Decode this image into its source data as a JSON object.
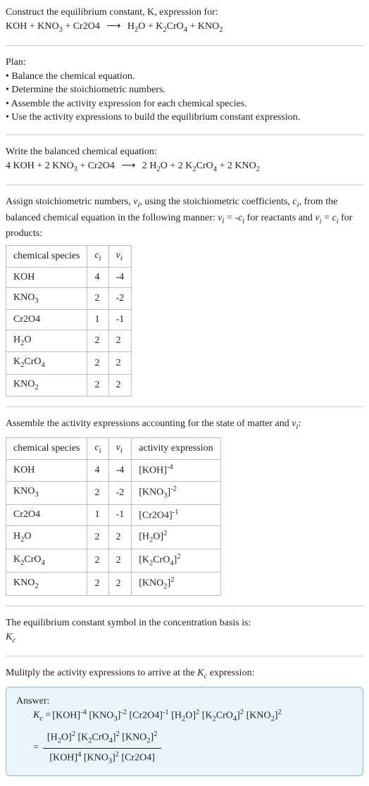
{
  "s1": {
    "intro": "Construct the equilibrium constant, K, expression for:",
    "equation": "KOH + KNO₃ + Cr2O4  ⟶  H₂O + K₂CrO₄ + KNO₂"
  },
  "plan": {
    "title": "Plan:",
    "b1": "• Balance the chemical equation.",
    "b2": "• Determine the stoichiometric numbers.",
    "b3": "• Assemble the activity expression for each chemical species.",
    "b4": "• Use the activity expressions to build the equilibrium constant expression."
  },
  "balanced": {
    "title": "Write the balanced chemical equation:",
    "equation": "4 KOH + 2 KNO₃ + Cr2O4  ⟶  2 H₂O + 2 K₂CrO₄ + 2 KNO₂"
  },
  "stoich": {
    "intro": "Assign stoichiometric numbers, νᵢ, using the stoichiometric coefficients, cᵢ, from the balanced chemical equation in the following manner: νᵢ = -cᵢ for reactants and νᵢ = cᵢ for products:",
    "headers": {
      "h1": "chemical species",
      "h2": "cᵢ",
      "h3": "νᵢ"
    },
    "rows": [
      {
        "sp": "KOH",
        "c": "4",
        "v": "-4"
      },
      {
        "sp": "KNO₃",
        "c": "2",
        "v": "-2"
      },
      {
        "sp": "Cr2O4",
        "c": "1",
        "v": "-1"
      },
      {
        "sp": "H₂O",
        "c": "2",
        "v": "2"
      },
      {
        "sp": "K₂CrO₄",
        "c": "2",
        "v": "2"
      },
      {
        "sp": "KNO₂",
        "c": "2",
        "v": "2"
      }
    ]
  },
  "activity": {
    "intro": "Assemble the activity expressions accounting for the state of matter and νᵢ:",
    "headers": {
      "h1": "chemical species",
      "h2": "cᵢ",
      "h3": "νᵢ",
      "h4": "activity expression"
    },
    "rows": [
      {
        "sp": "KOH",
        "c": "4",
        "v": "-4",
        "ae": "[KOH]⁻⁴"
      },
      {
        "sp": "KNO₃",
        "c": "2",
        "v": "-2",
        "ae": "[KNO₃]⁻²"
      },
      {
        "sp": "Cr2O4",
        "c": "1",
        "v": "-1",
        "ae": "[Cr2O4]⁻¹"
      },
      {
        "sp": "H₂O",
        "c": "2",
        "v": "2",
        "ae": "[H₂O]²"
      },
      {
        "sp": "K₂CrO₄",
        "c": "2",
        "v": "2",
        "ae": "[K₂CrO₄]²"
      },
      {
        "sp": "KNO₂",
        "c": "2",
        "v": "2",
        "ae": "[KNO₂]²"
      }
    ]
  },
  "kc_symbol": {
    "line1": "The equilibrium constant symbol in the concentration basis is:",
    "line2": "K_c"
  },
  "final": {
    "intro": "Mulitply the activity expressions to arrive at the K_c expression:",
    "answer_label": "Answer:",
    "kc_eq_lhs": "K_c = ",
    "flat_expr": "[KOH]⁻⁴ [KNO₃]⁻² [Cr2O4]⁻¹ [H₂O]² [K₂CrO₄]² [KNO₂]²",
    "eq2": " = ",
    "numerator": "[H₂O]² [K₂CrO₄]² [KNO₂]²",
    "denominator": "[KOH]⁴ [KNO₃]² [Cr2O4]"
  }
}
